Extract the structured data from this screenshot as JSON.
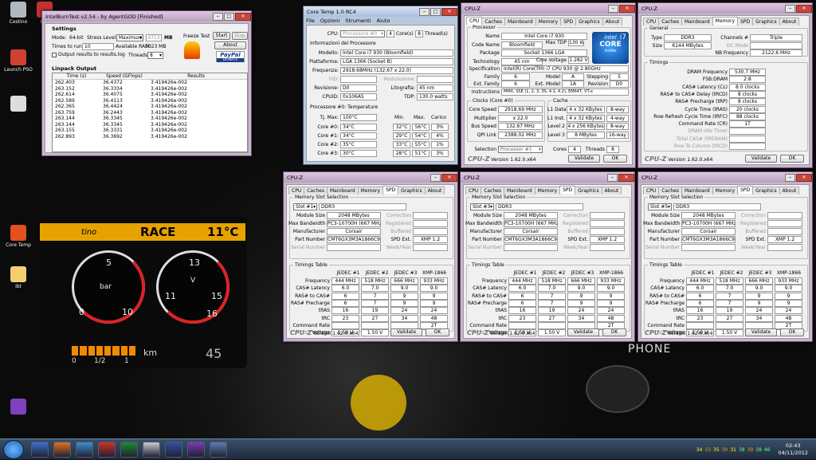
{
  "desktop": {
    "icons": [
      {
        "label": "Cestino",
        "color": "#b0b8c0"
      },
      {
        "label": "HW",
        "color": "#c83030"
      },
      {
        "label": "Launch PSO",
        "color": "#d04030"
      },
      {
        "label": "",
        "color": "#ddd"
      },
      {
        "label": "Core Temp",
        "color": "#e05020"
      },
      {
        "label": "ibt",
        "color": "#f0d070"
      },
      {
        "label": "",
        "color": "#8040c0"
      }
    ],
    "dash": {
      "mode": "RACE",
      "temp": "11°C",
      "brand": "tino",
      "km": "km",
      "fuel_left": "0",
      "fuel_mid": "1/2",
      "fuel_right": "1",
      "phone": "PHONE",
      "speed": "45",
      "rpm": [
        "5",
        "bar",
        "0",
        "10"
      ],
      "g2": [
        "13",
        "V",
        "11",
        "15",
        "16"
      ]
    }
  },
  "ibt": {
    "title": "IntelBurnTest v2.54 - by AgentGOD [Finished]",
    "settings_label": "Settings",
    "mode_label": "Mode:",
    "mode": "64-bit",
    "stress_label": "Stress Level:",
    "stress": "Maximum",
    "mb": "4713",
    "mb_unit": "MB",
    "times_label": "Times to run:",
    "times": "10",
    "avail_label": "Available RAM:",
    "avail": "5023 MB",
    "threads_label": "Threads:",
    "threads": "8",
    "output_chk": "Output results to results.log",
    "freeze": "Freeze Test",
    "start": "Start",
    "stop": "Stop",
    "about": "About",
    "paypal": "PayPal",
    "donate": "DONATE",
    "linpack_label": "Linpack Output",
    "cols": [
      "Time (s)",
      "Speed (GFlops)",
      "Results"
    ],
    "rows": [
      [
        "262.403",
        "36.4372",
        "3.419426e-002"
      ],
      [
        "263.152",
        "36.3334",
        "3.419426e-002"
      ],
      [
        "262.614",
        "36.4075",
        "3.419426e-002"
      ],
      [
        "262.589",
        "36.4113",
        "3.419426e-002"
      ],
      [
        "262.365",
        "36.4424",
        "3.419426e-002"
      ],
      [
        "263.759",
        "36.2443",
        "3.419426e-002"
      ],
      [
        "263.144",
        "36.3345",
        "3.419426e-002"
      ],
      [
        "263.144",
        "36.3345",
        "3.419426e-002"
      ],
      [
        "263.155",
        "36.3331",
        "3.419426e-002"
      ],
      [
        "262.893",
        "36.3692",
        "3.419426e-002"
      ]
    ]
  },
  "coretemp": {
    "title": "Core Temp 1.0 RC4",
    "menu": [
      "File",
      "Opzioni",
      "Strumenti",
      "Aiuto"
    ],
    "cpu_label": "CPU:",
    "cpu": "Processore #0",
    "cores": "4",
    "cores_label": "Core(s)",
    "threads": "8",
    "threads_label": "Thread(s)",
    "info_label": "Informazioni del Processore",
    "model_label": "Modello:",
    "model": "Intel Core i7 930 (Bloomfield)",
    "platform_label": "Piattaforma:",
    "platform": "LGA 1366 (Socket B)",
    "freq_label": "Frequenza:",
    "freq": "2918.68MHz (132.67 x 22.0)",
    "vid_label": "VID:",
    "mod_label": "Modulazione:",
    "rev_label": "Revisione:",
    "rev": "D0",
    "lito_label": "Litografia:",
    "lito": "45 nm",
    "cpuid_label": "CPUID:",
    "cpuid": "0x106A5",
    "tdp_label": "TDP:",
    "tdp": "130.0 watts",
    "temp_label": "Processore #0: Temperature",
    "tj_label": "Tj. Max:",
    "tj": "100°C",
    "hdr": [
      "Min.",
      "Max.",
      "Carico"
    ],
    "cores_rows": [
      [
        "Core #0:",
        "34°C",
        "32°C",
        "56°C",
        "3%"
      ],
      [
        "Core #1:",
        "34°C",
        "29°C",
        "54°C",
        "4%"
      ],
      [
        "Core #2:",
        "35°C",
        "33°C",
        "55°C",
        "1%"
      ],
      [
        "Core #3:",
        "30°C",
        "28°C",
        "51°C",
        "3%"
      ]
    ]
  },
  "cpuz_cpu": {
    "title": "CPU-Z",
    "tabs": [
      "CPU",
      "Caches",
      "Mainboard",
      "Memory",
      "SPD",
      "Graphics",
      "About"
    ],
    "proc_label": "Processor",
    "rows": [
      [
        "Name",
        "Intel Core i7 930"
      ],
      [
        "Code Name",
        "Bloomfield"
      ],
      [
        "Package",
        "Socket 1366 LGA"
      ],
      [
        "Technology",
        "45 nm"
      ]
    ],
    "tdp_label": "Max TDP",
    "tdp": "130 W",
    "cv_label": "Core Voltage",
    "cv": "1.282 V",
    "spec_label": "Specification",
    "spec": "Intel(R) Core(TM) i7 CPU    930  @ 2.80GHz",
    "family_label": "Family",
    "family": "6",
    "model_label": "Model",
    "model": "A",
    "stepping_label": "Stepping",
    "stepping": "5",
    "extfam_label": "Ext. Family",
    "extfam": "6",
    "extmod_label": "Ext. Model",
    "extmod": "1A",
    "rev_label": "Revision",
    "rev": "D0",
    "instr_label": "Instructions",
    "instr": "MMX, SSE (1, 2, 3, 3S, 4.1, 4.2), EM64T, VT-x",
    "clocks_label": "Clocks (Core #0)",
    "clk": [
      [
        "Core Speed",
        "2918.69 MHz"
      ],
      [
        "Multiplier",
        "x 22.0"
      ],
      [
        "Bus Speed",
        "132.67 MHz"
      ],
      [
        "QPI Link",
        "2388.02 MHz"
      ]
    ],
    "cache_label": "Cache",
    "cache": [
      [
        "L1 Data",
        "4 x 32 KBytes",
        "8-way"
      ],
      [
        "L1 Inst.",
        "4 x 32 KBytes",
        "4-way"
      ],
      [
        "Level 2",
        "4 x 256 KBytes",
        "8-way"
      ],
      [
        "Level 3",
        "8 MBytes",
        "16-way"
      ]
    ],
    "selection_label": "Selection",
    "selection": "Processor #1",
    "cores_label": "Cores",
    "cores": "4",
    "threads_label": "Threads",
    "threads": "8",
    "logo_brand": "intel",
    "logo_core": "CORE",
    "logo_i7": "i7",
    "logo_inside": "inside",
    "version": "Version 1.62.0.x64",
    "validate": "Validate",
    "ok": "OK"
  },
  "cpuz_mem": {
    "title": "CPU-Z",
    "tabs": [
      "CPU",
      "Caches",
      "Mainboard",
      "Memory",
      "SPD",
      "Graphics",
      "About"
    ],
    "general_label": "General",
    "type_label": "Type",
    "type": "DDR3",
    "size_label": "Size",
    "size": "6144 MBytes",
    "channels_label": "Channels #",
    "channels": "Triple",
    "dc_label": "DC Mode",
    "nb_label": "NB Frequency",
    "nb": "2122.6 MHz",
    "timings_label": "Timings",
    "timings": [
      [
        "DRAM Frequency",
        "530.7 MHz"
      ],
      [
        "FSB:DRAM",
        "2:8"
      ],
      [
        "CAS# Latency (CL)",
        "8.0 clocks"
      ],
      [
        "RAS# to CAS# Delay (tRCD)",
        "8 clocks"
      ],
      [
        "RAS# Precharge (tRP)",
        "8 clocks"
      ],
      [
        "Cycle Time (tRAS)",
        "20 clocks"
      ],
      [
        "Row Refresh Cycle Time (tRFC)",
        "88 clocks"
      ],
      [
        "Command Rate (CR)",
        "1T"
      ],
      [
        "DRAM Idle Timer",
        ""
      ],
      [
        "Total CAS# (tRDRAM)",
        ""
      ],
      [
        "Row To Column (tRCD)",
        ""
      ]
    ],
    "version": "Version 1.62.0.x64",
    "validate": "Validate",
    "ok": "OK"
  },
  "spd": [
    {
      "slot": "Slot #1",
      "title": "CPU-Z"
    },
    {
      "slot": "Slot #3",
      "title": "CPU-Z"
    },
    {
      "slot": "Slot #5",
      "title": "CPU-Z"
    }
  ],
  "spd_common": {
    "tabs": [
      "CPU",
      "Caches",
      "Mainboard",
      "Memory",
      "SPD",
      "Graphics",
      "About"
    ],
    "mss_label": "Memory Slot Selection",
    "type": "DDR3",
    "ms_label": "Module Size",
    "ms": "2048 MBytes",
    "mb_label": "Max Bandwidth",
    "mb": "PC3-10700H (667 MHz)",
    "man_label": "Manufacturer",
    "man": "Corsair",
    "pn_label": "Part Number",
    "pn": "CMT6GX3M3A1866C9",
    "sn_label": "Serial Number",
    "corr": "Correction",
    "reg": "Registered",
    "buf": "Buffered",
    "spdext_label": "SPD Ext.",
    "spdext": "XMP 1.2",
    "wy": "Week/Year",
    "tt_label": "Timings Table",
    "hdr": [
      "JEDEC #1",
      "JEDEC #2",
      "JEDEC #3",
      "XMP-1866"
    ],
    "trows": [
      [
        "Frequency",
        "444 MHz",
        "518 MHz",
        "666 MHz",
        "933 MHz"
      ],
      [
        "CAS# Latency",
        "6.0",
        "7.0",
        "9.0",
        "9.0"
      ],
      [
        "RAS# to CAS#",
        "6",
        "7",
        "9",
        "9"
      ],
      [
        "RAS# Precharge",
        "6",
        "7",
        "9",
        "9"
      ],
      [
        "tRAS",
        "16",
        "19",
        "24",
        "24"
      ],
      [
        "tRC",
        "23",
        "27",
        "34",
        "48"
      ],
      [
        "Command Rate",
        "",
        "",
        "",
        "2T"
      ],
      [
        "Voltage",
        "1.50 V",
        "1.50 V",
        "1.50 V",
        "1.650 V"
      ]
    ],
    "version": "Version 1.62.0.x64",
    "validate": "Validate",
    "ok": "OK"
  },
  "taskbar": {
    "time": "02:43",
    "date": "04/11/2012",
    "apps": [
      {
        "c": "#3a6fd0"
      },
      {
        "c": "#e07020"
      },
      {
        "c": "#3a90d0"
      },
      {
        "c": "#d03020"
      },
      {
        "c": "#1f8a30"
      },
      {
        "c": "#ccc"
      },
      {
        "c": "#3050a0"
      },
      {
        "c": "#7a3ab0"
      },
      {
        "c": "#5a7fb0"
      }
    ],
    "tray": [
      "34",
      "33",
      "35",
      "30",
      "31",
      "38",
      "39",
      "38",
      "46"
    ]
  }
}
